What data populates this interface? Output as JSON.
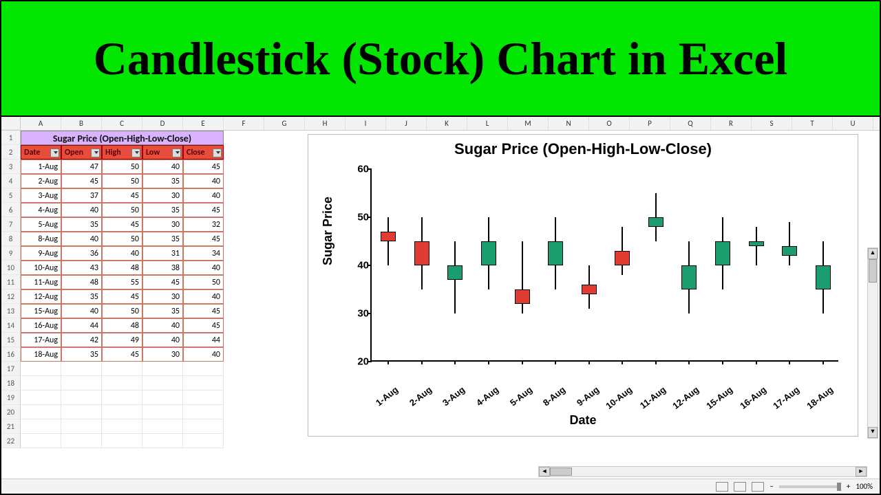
{
  "banner": {
    "title": "Candlestick (Stock) Chart in Excel"
  },
  "columns": [
    "A",
    "B",
    "C",
    "D",
    "E",
    "F",
    "G",
    "H",
    "I",
    "J",
    "K",
    "L",
    "M",
    "N",
    "O",
    "P",
    "Q",
    "R",
    "S",
    "T",
    "U"
  ],
  "row_numbers": [
    1,
    2,
    3,
    4,
    5,
    6,
    7,
    8,
    9,
    10,
    11,
    12,
    13,
    14,
    15,
    16,
    17,
    18,
    19,
    20,
    21,
    22
  ],
  "table": {
    "title": "Sugar Price (Open-High-Low-Close)",
    "headers": [
      "Date",
      "Open",
      "High",
      "Low",
      "Close"
    ],
    "rows": [
      {
        "date": "1-Aug",
        "open": 47,
        "high": 50,
        "low": 40,
        "close": 45
      },
      {
        "date": "2-Aug",
        "open": 45,
        "high": 50,
        "low": 35,
        "close": 40
      },
      {
        "date": "3-Aug",
        "open": 37,
        "high": 45,
        "low": 30,
        "close": 40
      },
      {
        "date": "4-Aug",
        "open": 40,
        "high": 50,
        "low": 35,
        "close": 45
      },
      {
        "date": "5-Aug",
        "open": 35,
        "high": 45,
        "low": 30,
        "close": 32
      },
      {
        "date": "8-Aug",
        "open": 40,
        "high": 50,
        "low": 35,
        "close": 45
      },
      {
        "date": "9-Aug",
        "open": 36,
        "high": 40,
        "low": 31,
        "close": 34
      },
      {
        "date": "10-Aug",
        "open": 43,
        "high": 48,
        "low": 38,
        "close": 40
      },
      {
        "date": "11-Aug",
        "open": 48,
        "high": 55,
        "low": 45,
        "close": 50
      },
      {
        "date": "12-Aug",
        "open": 35,
        "high": 45,
        "low": 30,
        "close": 40
      },
      {
        "date": "15-Aug",
        "open": 40,
        "high": 50,
        "low": 35,
        "close": 45
      },
      {
        "date": "16-Aug",
        "open": 44,
        "high": 48,
        "low": 40,
        "close": 45
      },
      {
        "date": "17-Aug",
        "open": 42,
        "high": 49,
        "low": 40,
        "close": 44
      },
      {
        "date": "18-Aug",
        "open": 35,
        "high": 45,
        "low": 30,
        "close": 40
      }
    ]
  },
  "chart_data": {
    "type": "candlestick",
    "title": "Sugar Price (Open-High-Low-Close)",
    "xlabel": "Date",
    "ylabel": "Sugar Price",
    "ylim": [
      20,
      60
    ],
    "yticks": [
      20,
      30,
      40,
      50,
      60
    ],
    "categories": [
      "1-Aug",
      "2-Aug",
      "3-Aug",
      "4-Aug",
      "5-Aug",
      "8-Aug",
      "9-Aug",
      "10-Aug",
      "11-Aug",
      "12-Aug",
      "15-Aug",
      "16-Aug",
      "17-Aug",
      "18-Aug"
    ],
    "series": [
      {
        "name": "Open",
        "values": [
          47,
          45,
          37,
          40,
          35,
          40,
          36,
          43,
          48,
          35,
          40,
          44,
          42,
          35
        ]
      },
      {
        "name": "High",
        "values": [
          50,
          50,
          45,
          50,
          45,
          50,
          40,
          48,
          55,
          45,
          50,
          48,
          49,
          45
        ]
      },
      {
        "name": "Low",
        "values": [
          40,
          35,
          30,
          35,
          30,
          35,
          31,
          38,
          45,
          30,
          35,
          40,
          40,
          30
        ]
      },
      {
        "name": "Close",
        "values": [
          45,
          40,
          40,
          45,
          32,
          45,
          34,
          40,
          50,
          40,
          45,
          45,
          44,
          40
        ]
      }
    ],
    "colors": {
      "up": "#1a9e6f",
      "down": "#e03c31"
    }
  },
  "statusbar": {
    "zoom": "100%"
  }
}
